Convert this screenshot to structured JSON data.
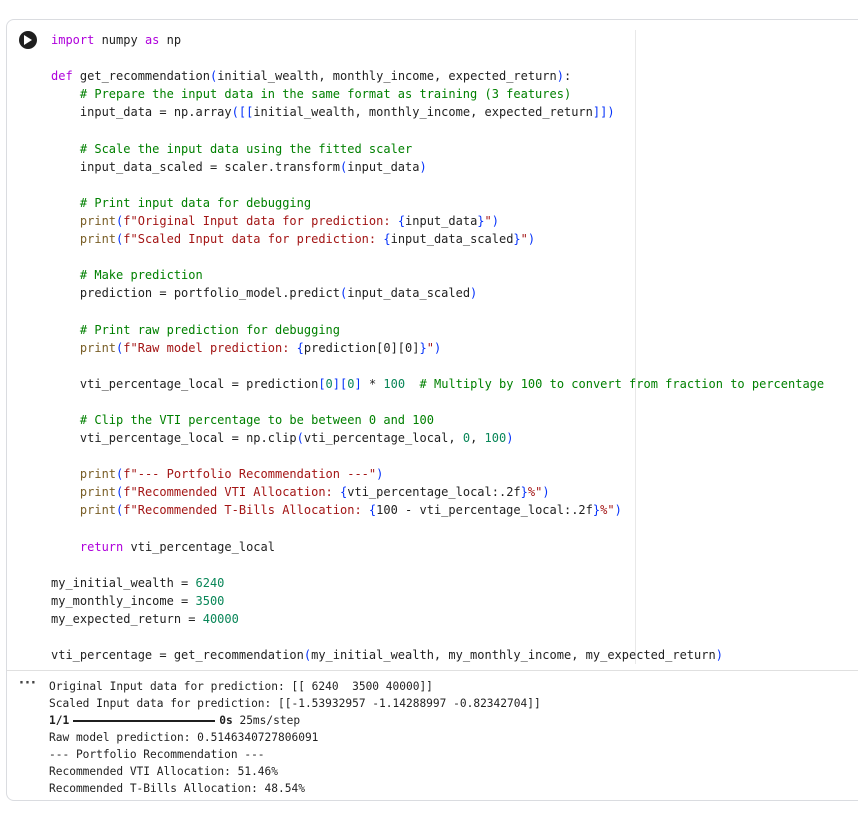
{
  "cell": {
    "run_button_label": "Run cell",
    "code_lines": [
      "import numpy as np",
      "",
      "def get_recommendation(initial_wealth, monthly_income, expected_return):",
      "    # Prepare the input data in the same format as training (3 features)",
      "    input_data = np.array([[initial_wealth, monthly_income, expected_return]])",
      "",
      "    # Scale the input data using the fitted scaler",
      "    input_data_scaled = scaler.transform(input_data)",
      "",
      "    # Print input data for debugging",
      "    print(f\"Original Input data for prediction: {input_data}\")",
      "    print(f\"Scaled Input data for prediction: {input_data_scaled}\")",
      "",
      "    # Make prediction",
      "    prediction = portfolio_model.predict(input_data_scaled)",
      "",
      "    # Print raw prediction for debugging",
      "    print(f\"Raw model prediction: {prediction[0][0]}\")",
      "",
      "    vti_percentage_local = prediction[0][0] * 100  # Multiply by 100 to convert from fraction to percentage",
      "",
      "    # Clip the VTI percentage to be between 0 and 100",
      "    vti_percentage_local = np.clip(vti_percentage_local, 0, 100)",
      "",
      "    print(f\"--- Portfolio Recommendation ---\")",
      "    print(f\"Recommended VTI Allocation: {vti_percentage_local:.2f}%\")",
      "    print(f\"Recommended T-Bills Allocation: {100 - vti_percentage_local:.2f}%\")",
      "",
      "    return vti_percentage_local",
      "",
      "my_initial_wealth = 6240",
      "my_monthly_income = 3500",
      "my_expected_return = 40000",
      "",
      "vti_percentage = get_recommendation(my_initial_wealth, my_monthly_income, my_expected_return)"
    ]
  },
  "output": {
    "menu_icon": "ellipsis-icon",
    "lines": [
      "Original Input data for prediction: [[ 6240  3500 40000]]",
      "Scaled Input data for prediction: [[-1.53932957 -1.14288997 -0.82342704]]",
      "",
      "Raw model prediction: 0.5146340727806091",
      "--- Portfolio Recommendation ---",
      "Recommended VTI Allocation: 51.46%",
      "Recommended T-Bills Allocation: 48.54%"
    ],
    "progress": {
      "step": "1/1",
      "timing": "0s",
      "rate": "25ms/step",
      "fraction": 1.0
    }
  },
  "colors": {
    "keyword": "#af00db",
    "function": "#795e26",
    "comment": "#008000",
    "string": "#a31515",
    "number": "#098658",
    "bracket": "#0431fa"
  }
}
